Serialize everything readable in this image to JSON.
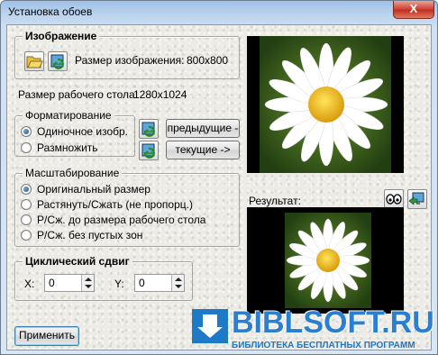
{
  "window": {
    "title": "Установка обоев",
    "close_label": "X"
  },
  "image_group": {
    "legend": "Изображение",
    "size_label": "Размер изображения:",
    "size_value": "800x800",
    "open_icon": "folder-open-icon",
    "refresh_icon": "picture-refresh-icon"
  },
  "desktop": {
    "label": "Размер рабочего стола:",
    "value": "1280x1024"
  },
  "formatting": {
    "legend": "Форматирование",
    "options": [
      {
        "label": "Одиночное изобр.",
        "selected": true
      },
      {
        "label": "Размножить",
        "selected": false
      }
    ],
    "prev_button": "предыдущие ->",
    "current_button": "текущие ->"
  },
  "scaling": {
    "legend": "Масштабирование",
    "options": [
      {
        "label": "Оригинальный размер",
        "selected": true
      },
      {
        "label": "Растянуть/Сжать (не пропорц.)",
        "selected": false
      },
      {
        "label": "Р/Сж. до размера рабочего стола",
        "selected": false
      },
      {
        "label": "Р/Сж. без пустых зон",
        "selected": false
      }
    ]
  },
  "shift": {
    "legend": "Циклический сдвиг",
    "x_label": "X:",
    "x_value": "0",
    "y_label": "Y:",
    "y_value": "0"
  },
  "result": {
    "label": "Результат:",
    "preview_icon": "eyes-icon",
    "apply_icon": "monitor-arrow-icon"
  },
  "apply_button": "Применить",
  "watermark": {
    "title": "BIBLSOFT.RU",
    "subtitle": "БИБЛИОТЕКА БЕСПЛАТНЫХ ПРОГРАММ"
  },
  "colors": {
    "accent": "#1e79c6",
    "petal": "#ffffff",
    "center": "#f3c31a"
  }
}
